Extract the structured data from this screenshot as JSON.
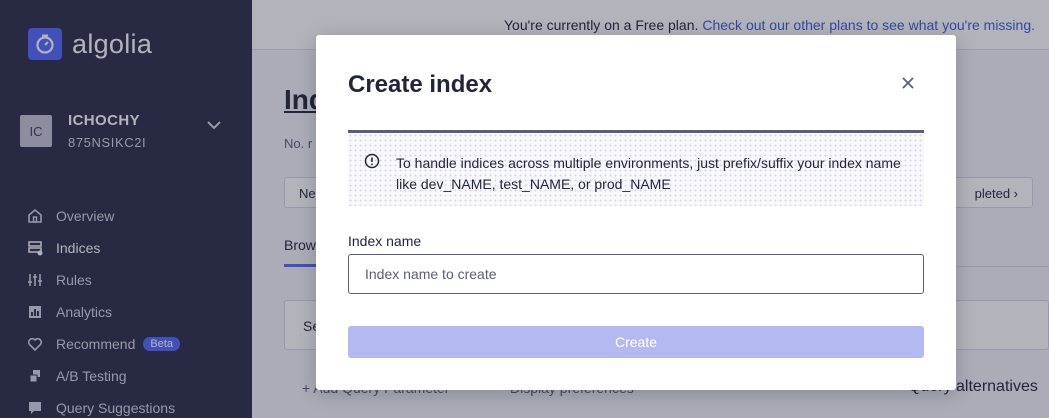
{
  "brand": {
    "name": "algolia",
    "icon": "stopwatch-icon",
    "color": "#5468ff"
  },
  "account": {
    "avatar": "IC",
    "name": "ICHOCHY",
    "id": "875NSIKC2I"
  },
  "sidebar": {
    "items": [
      {
        "label": "Overview",
        "icon": "home-icon"
      },
      {
        "label": "Indices",
        "icon": "database-icon",
        "active": true
      },
      {
        "label": "Rules",
        "icon": "sliders-icon"
      },
      {
        "label": "Analytics",
        "icon": "chart-icon"
      },
      {
        "label": "Recommend",
        "icon": "heart-icon",
        "badge": "Beta"
      },
      {
        "label": "A/B Testing",
        "icon": "ab-icon"
      },
      {
        "label": "Query Suggestions",
        "icon": "chat-icon"
      }
    ]
  },
  "plan_bar": {
    "text": "You're currently on a Free plan.",
    "link": "Check out our other plans to see what you're missing."
  },
  "background": {
    "title": "Indi",
    "subtitle": "No. r",
    "left_button": "Ne",
    "right_button": "pleted",
    "tab": "Brow",
    "search": "Se",
    "bottom_left": "+ Add Query Parameter",
    "bottom_mid": "Display preferences",
    "bottom_right": "Query alternatives"
  },
  "modal": {
    "title": "Create index",
    "info": "To handle indices across multiple environments, just prefix/suffix your index name like dev_NAME, test_NAME, or prod_NAME",
    "field_label": "Index name",
    "field_placeholder": "Index name to create",
    "field_value": "",
    "create_label": "Create"
  }
}
